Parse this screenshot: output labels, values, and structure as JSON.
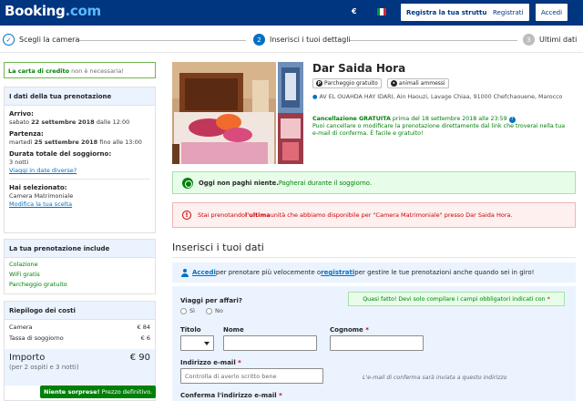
{
  "header": {
    "logo_main": "Booking",
    "logo_tld": ".com",
    "currency": "€",
    "list_property": "Registra la tua struttura",
    "register": "Registrati",
    "login": "Accedi",
    "colors": {
      "brand": "#003580",
      "link": "#0071c2",
      "success": "#008009",
      "danger": "#cc0000"
    }
  },
  "steps": [
    {
      "num": "✓",
      "label": "Scegli la camera",
      "state": "done"
    },
    {
      "num": "2",
      "label": "Inserisci i tuoi dettagli",
      "state": "current"
    },
    {
      "num": "3",
      "label": "Ultimi dati",
      "state": "todo"
    }
  ],
  "sidebar": {
    "credit_card_note": {
      "em": "La carta di credito",
      "rest": " non è necessaria!"
    },
    "booking": {
      "title": "I dati della tua prenotazione",
      "arrival_label": "Arrivo:",
      "arrival_day": "sabato",
      "arrival_date": "22 settembre 2018",
      "arrival_time": "dalle 12:00",
      "departure_label": "Partenza:",
      "departure_day": "martedì",
      "departure_date": "25 settembre 2018",
      "departure_time": "fino alle 13:00",
      "duration_label": "Durata totale del soggiorno:",
      "duration_value": "3 notti",
      "change_dates_link": "Viaggi in date diverse?",
      "selected_label": "Hai selezionato:",
      "selected_value": "Camera Matrimoniale",
      "change_choice_link": "Modifica la tua scelta"
    },
    "includes": {
      "title": "La tua prenotazione include",
      "items": [
        "Colazione",
        "WiFi gratis",
        "Parcheggio gratuito"
      ]
    },
    "costs": {
      "title": "Riepilogo dei costi",
      "rows": [
        {
          "label": "Camera",
          "value": "€ 84"
        },
        {
          "label": "Tassa di soggiorno",
          "value": "€ 6"
        }
      ],
      "total_label": "Importo",
      "total_value": "€ 90",
      "total_note": "(per 2 ospiti e 3 notti)",
      "surprise_em": "Niente sorprese!",
      "surprise_rest": " Prezzo definitivo."
    }
  },
  "hotel": {
    "name": "Dar Saida Hora",
    "facilities": [
      "Parcheggio gratuito",
      "animali ammessi"
    ],
    "address": "AV EL OUAHDA HAY IDARI, Ain Haouzi, Lavage Chiaa, 91000 Chefchaouene, Marocco",
    "cancel_em": "Cancellazione GRATUITA",
    "cancel_rest": " prima del 18 settembre 2018 alle 23:59",
    "cancel_note": "Puoi cancellare o modificare la prenotazione direttamente dal link che troverai nella tua e-mail di conferma. È facile e gratuito!"
  },
  "banners": {
    "pay_em": "Oggi non paghi niente.",
    "pay_rest": " Pagherai durante il soggiorno.",
    "last_pre": "Stai prenotando ",
    "last_em": "l'ultima",
    "last_rest": " unità che abbiamo disponibile per \"Camera Matrimoniale\" presso Dar Saida Hora."
  },
  "form": {
    "title": "Inserisci i tuoi dati",
    "signin_link": "Accedi",
    "signin_mid": " per prenotare più velocemente o ",
    "register_link": "registrati",
    "signin_end": " per gestire le tue prenotazioni anche quando sei in giro!",
    "business_label": "Viaggi per affari?",
    "yes": "Sì",
    "no": "No",
    "almost_done": "Quasi fatto! Devi solo compilare i campi obbligatori indicati con",
    "title_label": "Titolo",
    "first_name_label": "Nome",
    "last_name_label": "Cognome",
    "email_label": "Indirizzo e-mail",
    "email_placeholder": "Controlla di averlo scritto bene",
    "email_hint": "L'e-mail di conferma sarà inviata a questo indirizzo",
    "confirm_email_label": "Conferma l'indirizzo e-mail"
  }
}
